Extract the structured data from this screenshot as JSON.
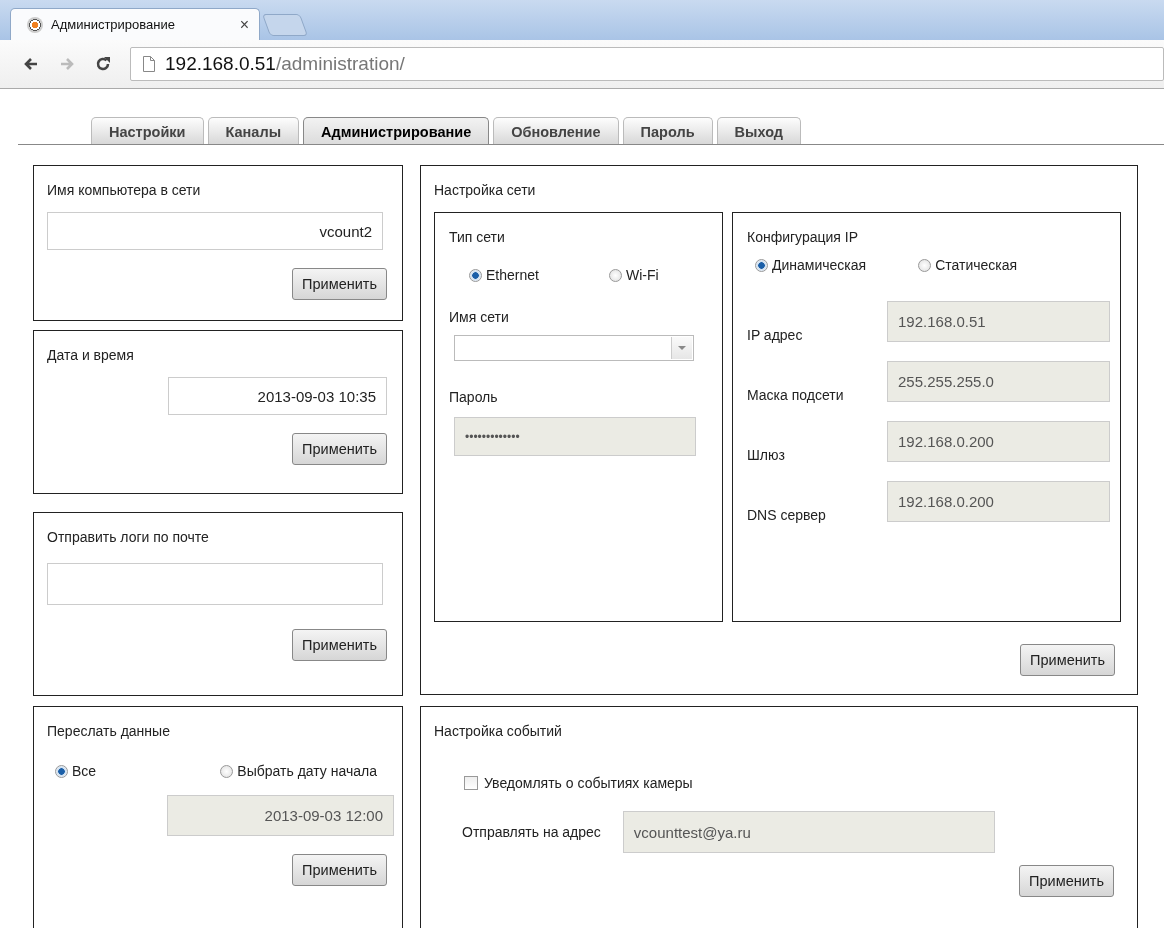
{
  "browser": {
    "tab_title": "Администрирование",
    "close": "×",
    "address_host": "192.168.0.51",
    "address_path": "/administration/"
  },
  "nav_tabs": [
    {
      "label": "Настройки",
      "selected": false
    },
    {
      "label": "Каналы",
      "selected": false
    },
    {
      "label": "Администрирование",
      "selected": true
    },
    {
      "label": "Обновление",
      "selected": false
    },
    {
      "label": "Пароль",
      "selected": false
    },
    {
      "label": "Выход",
      "selected": false
    }
  ],
  "computer_name": {
    "title": "Имя компьютера в сети",
    "value": "vcount2",
    "button": "Применить"
  },
  "date_time": {
    "title": "Дата и время",
    "value": "2013-09-03 10:35",
    "button": "Применить"
  },
  "send_logs": {
    "title": "Отправить логи по почте",
    "button": "Применить"
  },
  "resend_data": {
    "title": "Переслать данные",
    "options": [
      {
        "label": "Все",
        "selected": true
      },
      {
        "label": "Выбрать дату начала",
        "selected": false
      }
    ],
    "date": {
      "value": "2013-09-03 12:00",
      "disabled": true
    },
    "button": "Применить"
  },
  "network": {
    "title": "Настройка сети",
    "type": {
      "title": "Тип сети",
      "options": [
        {
          "label": "Ethernet",
          "selected": true
        },
        {
          "label": "Wi-Fi",
          "selected": false
        }
      ],
      "network_name_label": "Имя сети",
      "password_label": "Пароль",
      "password": {
        "value": "•••••••••••••",
        "disabled": true
      }
    },
    "ip": {
      "title": "Конфигурация IP",
      "options": [
        {
          "label": "Динамическая",
          "selected": true
        },
        {
          "label": "Статическая",
          "selected": false
        }
      ],
      "fields": [
        {
          "label": "IP адрес",
          "value": "192.168.0.51",
          "disabled": true
        },
        {
          "label": "Маска подсети",
          "value": "255.255.255.0",
          "disabled": true
        },
        {
          "label": "Шлюз",
          "value": "192.168.0.200",
          "disabled": true
        },
        {
          "label": "DNS сервер",
          "value": "192.168.0.200",
          "disabled": true
        }
      ]
    },
    "button": "Применить"
  },
  "events": {
    "title": "Настройка событий",
    "notify": {
      "label": "Уведомлять о событиях камеры",
      "checked": false
    },
    "address_label": "Отправлять на адрес",
    "address": {
      "value": "vcounttest@ya.ru",
      "disabled": true
    },
    "button": "Применить"
  }
}
